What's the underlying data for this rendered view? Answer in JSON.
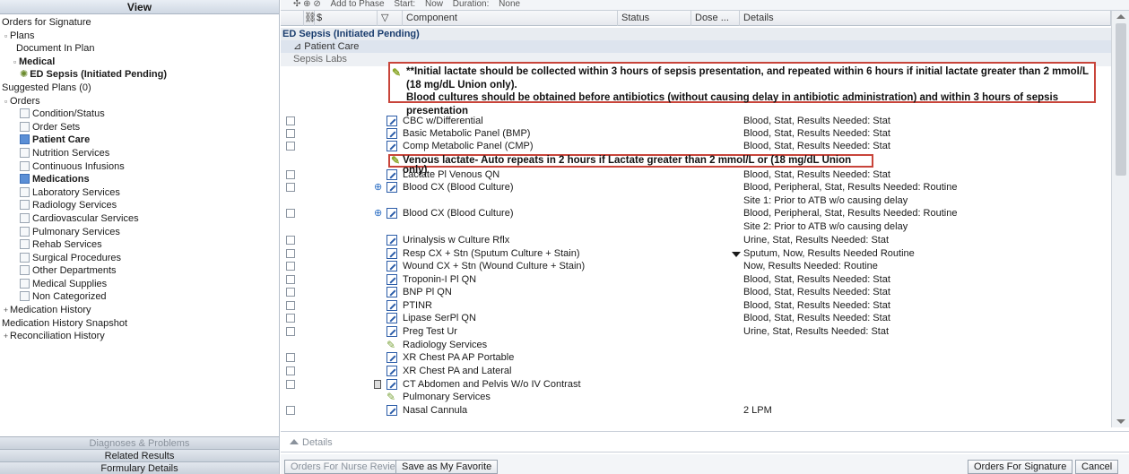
{
  "left_panel": {
    "header": "View",
    "tree": [
      {
        "label": "Orders for Signature",
        "indent": 0,
        "exp": "",
        "cb": false,
        "bold": false
      },
      {
        "label": "Plans",
        "indent": 0,
        "exp": "-",
        "cb": false,
        "bold": false
      },
      {
        "label": "Document In Plan",
        "indent": 2,
        "exp": "",
        "cb": false,
        "bold": false
      },
      {
        "label": "Medical",
        "indent": 1,
        "exp": "-",
        "cb": false,
        "bold": true
      },
      {
        "label": "ED Sepsis (Initiated Pending)",
        "indent": 3,
        "exp": "",
        "cb": false,
        "bold": true,
        "icon": "plan-icon"
      },
      {
        "label": "Suggested Plans (0)",
        "indent": 0,
        "exp": "",
        "cb": false,
        "bold": false
      },
      {
        "label": "Orders",
        "indent": 0,
        "exp": "-",
        "cb": false,
        "bold": false
      },
      {
        "label": "Condition/Status",
        "indent": 3,
        "exp": "",
        "cb": "empty",
        "bold": false
      },
      {
        "label": "Order Sets",
        "indent": 3,
        "exp": "",
        "cb": "empty",
        "bold": false
      },
      {
        "label": "Patient Care",
        "indent": 3,
        "exp": "",
        "cb": "checked",
        "bold": true
      },
      {
        "label": "Nutrition Services",
        "indent": 3,
        "exp": "",
        "cb": "empty",
        "bold": false
      },
      {
        "label": "Continuous Infusions",
        "indent": 3,
        "exp": "",
        "cb": "empty",
        "bold": false
      },
      {
        "label": "Medications",
        "indent": 3,
        "exp": "",
        "cb": "checked",
        "bold": true
      },
      {
        "label": "Laboratory Services",
        "indent": 3,
        "exp": "",
        "cb": "empty",
        "bold": false
      },
      {
        "label": "Radiology Services",
        "indent": 3,
        "exp": "",
        "cb": "empty",
        "bold": false
      },
      {
        "label": "Cardiovascular Services",
        "indent": 3,
        "exp": "",
        "cb": "empty",
        "bold": false
      },
      {
        "label": "Pulmonary Services",
        "indent": 3,
        "exp": "",
        "cb": "empty",
        "bold": false
      },
      {
        "label": "Rehab Services",
        "indent": 3,
        "exp": "",
        "cb": "empty",
        "bold": false
      },
      {
        "label": "Surgical Procedures",
        "indent": 3,
        "exp": "",
        "cb": "empty",
        "bold": false
      },
      {
        "label": "Other Departments",
        "indent": 3,
        "exp": "",
        "cb": "empty",
        "bold": false
      },
      {
        "label": "Medical Supplies",
        "indent": 3,
        "exp": "",
        "cb": "empty",
        "bold": false
      },
      {
        "label": "Non Categorized",
        "indent": 3,
        "exp": "",
        "cb": "empty",
        "bold": false
      },
      {
        "label": "Medication History",
        "indent": 0,
        "exp": "+",
        "cb": false,
        "bold": false
      },
      {
        "label": "Medication History Snapshot",
        "indent": 0,
        "exp": "",
        "cb": false,
        "bold": false
      },
      {
        "label": "Reconciliation History",
        "indent": 0,
        "exp": "+",
        "cb": false,
        "bold": false
      }
    ],
    "bottom_buttons": [
      {
        "label": "Diagnoses & Problems",
        "disabled": true
      },
      {
        "label": "Related Results",
        "disabled": false
      },
      {
        "label": "Formulary Details",
        "disabled": false
      }
    ]
  },
  "toolbar": {
    "items": [
      "Add to Phase",
      "Start:",
      "Now",
      "Duration:",
      "None"
    ]
  },
  "grid": {
    "columns": [
      "$",
      "Component",
      "Status",
      "Dose ...",
      "Details"
    ],
    "plan_row": "ED Sepsis (Initiated Pending)",
    "patient_care": "Patient Care",
    "sepsis_labs": "Sepsis Labs",
    "note1": "**Initial lactate should be collected within 3 hours of sepsis presentation, and repeated within 6 hours if initial lactate greater than 2 mmol/L (18 mg/dL Union only).",
    "note1_b": "Blood cultures should be obtained before antibiotics (without causing delay in antibiotic administration) and within 3 hours of sepsis presentation",
    "note2": "Venous lactate- Auto repeats in 2 hours if Lactate greater than 2 mmol/L or (18 mg/dL Union only)",
    "orders": [
      {
        "name": "CBC w/Differential",
        "details": "Blood, Stat, Results Needed: Stat"
      },
      {
        "name": "Basic Metabolic Panel (BMP)",
        "details": "Blood, Stat, Results Needed: Stat"
      },
      {
        "name": "Comp Metabolic Panel (CMP)",
        "details": "Blood, Stat, Results Needed: Stat"
      },
      {
        "name": "Lactate Pl Venous QN",
        "details": "Blood, Stat, Results Needed: Stat"
      },
      {
        "name": "Blood CX (Blood Culture)",
        "details": "Blood, Peripheral, Stat, Results Needed: Routine",
        "details2": "Site 1:  Prior to ATB w/o causing delay"
      },
      {
        "name": "Blood CX (Blood Culture)",
        "details": "Blood, Peripheral, Stat, Results Needed: Routine",
        "details2": "Site 2:  Prior to ATB w/o causing delay"
      },
      {
        "name": "Urinalysis w Culture Rflx",
        "details": "Urine, Stat, Results Needed: Stat"
      },
      {
        "name": "Resp CX + Stn (Sputum Culture + Stain)",
        "details": "Sputum, Now, Results Needed Routine"
      },
      {
        "name": "Wound CX + Stn (Wound Culture + Stain)",
        "details": "Now, Results Needed: Routine"
      },
      {
        "name": "Troponin-I Pl QN",
        "details": "Blood, Stat, Results Needed: Stat"
      },
      {
        "name": "BNP Pl QN",
        "details": "Blood, Stat, Results Needed: Stat"
      },
      {
        "name": "PTINR",
        "details": "Blood, Stat, Results Needed: Stat"
      },
      {
        "name": "Lipase SerPl QN",
        "details": "Blood, Stat, Results Needed: Stat"
      },
      {
        "name": "Preg Test Ur",
        "details": "Urine, Stat, Results Needed: Stat"
      },
      {
        "name": "Radiology Services",
        "details": ""
      },
      {
        "name": "XR Chest PA AP Portable",
        "details": ""
      },
      {
        "name": "XR Chest PA and Lateral",
        "details": ""
      },
      {
        "name": "CT Abdomen and Pelvis W/o IV Contrast",
        "details": ""
      },
      {
        "name": "Pulmonary Services",
        "details": ""
      },
      {
        "name": "Nasal Cannula",
        "details": "2 LPM"
      }
    ]
  },
  "details_bar": "Details",
  "bottom_bar": {
    "nurse_review": "Orders For Nurse Review",
    "save_favorite": "Save as My Favorite",
    "orders_for_signature": "Orders For Signature",
    "cancel": "Cancel"
  }
}
